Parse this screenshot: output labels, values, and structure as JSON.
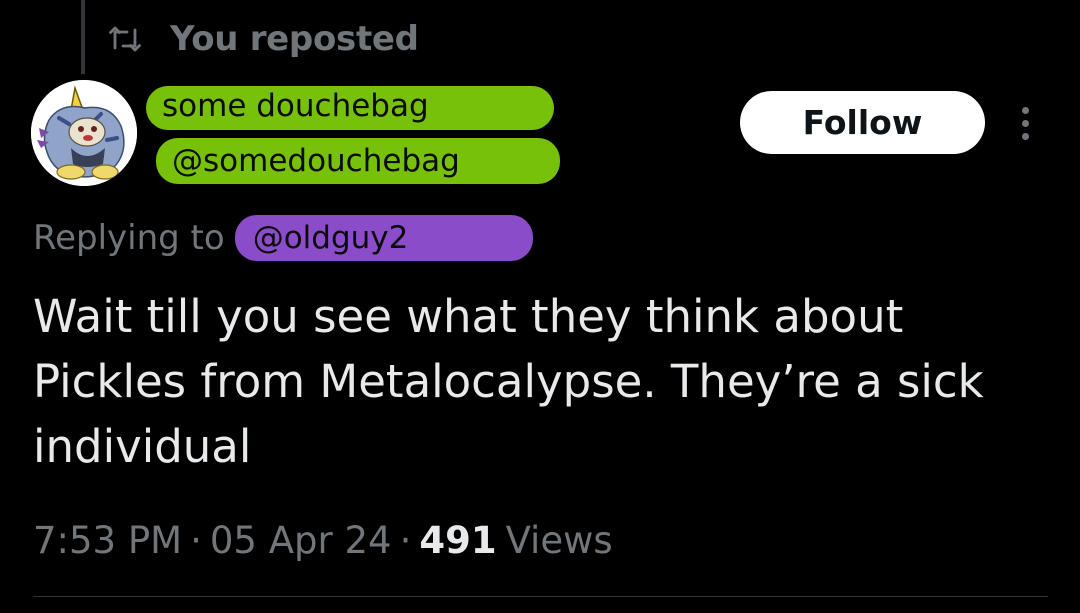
{
  "repost": {
    "icon": "repost-icon",
    "label": "You reposted"
  },
  "author": {
    "avatar_icon": "gabumon-avatar",
    "name": "some douchebag",
    "handle": "@somedouchebag",
    "name_highlight_color": "#77c10b"
  },
  "actions": {
    "follow_label": "Follow",
    "more_icon": "more-vertical-icon"
  },
  "reply": {
    "label": "Replying to",
    "handle": "@oldguy2",
    "highlight_color": "#8a4cc9"
  },
  "tweet": {
    "text": "Wait till you see what they think about Pickles from Metalocalypse. They’re a sick individual"
  },
  "meta": {
    "time": "7:53 PM",
    "separator": "·",
    "date": "05 Apr 24",
    "views_count": "491",
    "views_label": "Views"
  },
  "colors": {
    "background": "#000000",
    "primary_text": "#e7e9ea",
    "secondary_text": "#71767b",
    "follow_button": "#ffffff"
  }
}
